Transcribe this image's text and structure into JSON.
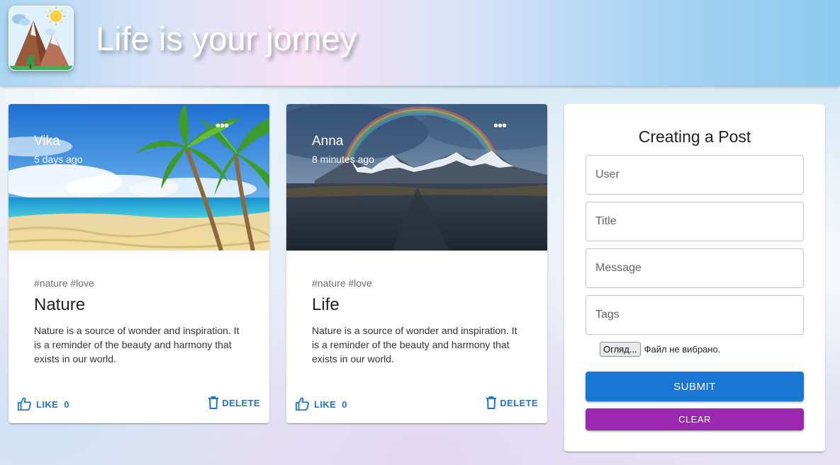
{
  "app": {
    "title": "Life is your jorney",
    "logo_icon": "mountain-sun-logo"
  },
  "colors": {
    "primary": "#1976d2",
    "secondary": "#9c27b0"
  },
  "posts": [
    {
      "author": "Vika",
      "time": "5 days ago",
      "tags": "#nature #love",
      "title": "Nature",
      "message": "Nature is a source of wonder and inspiration. It is a reminder of the beauty and harmony that exists in our world.",
      "image": "tropical-beach-with-palms",
      "like_label": "LIKE",
      "like_count": "0",
      "delete_label": "DELETE"
    },
    {
      "author": "Anna",
      "time": "8 minutes ago",
      "tags": "#nature #love",
      "title": "Life",
      "message": "Nature is a source of wonder and inspiration. It is a reminder of the beauty and harmony that exists in our world.",
      "image": "mountains-with-rainbow",
      "like_label": "LIKE",
      "like_count": "0",
      "delete_label": "DELETE"
    }
  ],
  "form": {
    "title": "Creating a Post",
    "user_placeholder": "User",
    "title_placeholder": "Title",
    "message_placeholder": "Message",
    "tags_placeholder": "Tags",
    "file_button": "Огляд...",
    "file_status": "Файл не вибрано.",
    "submit_label": "SUBMIT",
    "clear_label": "CLEAR"
  }
}
